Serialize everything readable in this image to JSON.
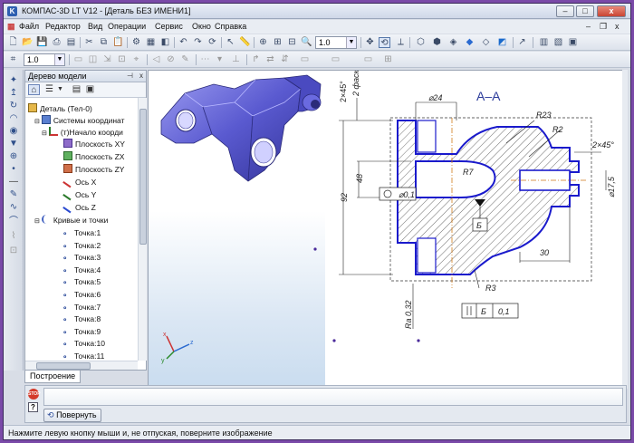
{
  "window": {
    "title": "КОМПАС-3D LT V12 - [Деталь БЕЗ ИМЕНИ1]",
    "app_icon": "K",
    "minimize": "–",
    "maximize": "□",
    "close": "x",
    "mdi_minimize": "–",
    "mdi_restore": "❐",
    "mdi_close": "x"
  },
  "menu": [
    "Файл",
    "Редактор",
    "Вид",
    "Операции",
    "Сервис",
    "Окно",
    "Справка"
  ],
  "toolbar": {
    "zoom_value": "1.0",
    "line_width": "1.0"
  },
  "tree": {
    "title": "Дерево модели",
    "pin": "⊣",
    "close": "x",
    "nodes": [
      "Деталь (Тел-0)",
      "Системы координат",
      "(т)Начало коорди",
      "Плоскость XY",
      "Плоскость ZX",
      "Плоскость ZY",
      "Ось X",
      "Ось Y",
      "Ось Z",
      "Кривые и точки",
      "Точка:1",
      "Точка:2",
      "Точка:3",
      "Точка:4",
      "Точка:5",
      "Точка:6",
      "Точка:7",
      "Точка:8",
      "Точка:9",
      "Точка:10",
      "Точка:11"
    ],
    "tab": "Построение"
  },
  "drawing": {
    "section_label": "A–A",
    "dims": [
      "2×45°",
      "2 фаски",
      "⌀24",
      "R23",
      "R2",
      "2×45°",
      "R7",
      "⌀0,1",
      "48",
      "92",
      "Б",
      "⌀17,5",
      "30",
      "R3",
      "Ra 0,32",
      "Б",
      "0,1"
    ]
  },
  "axis_labels": {
    "x": "x",
    "y": "y",
    "z": "z"
  },
  "command": {
    "rotate_button": "Повернуть",
    "stop": "STOP",
    "help": "?"
  },
  "status": {
    "text": "Нажмите левую кнопку мыши и, не отпуская, поверните изображение"
  },
  "colors": {
    "model": "#5f5fd6",
    "contour": "#1a1acc",
    "hatch": "#222222",
    "axis": "#d07a1a"
  }
}
